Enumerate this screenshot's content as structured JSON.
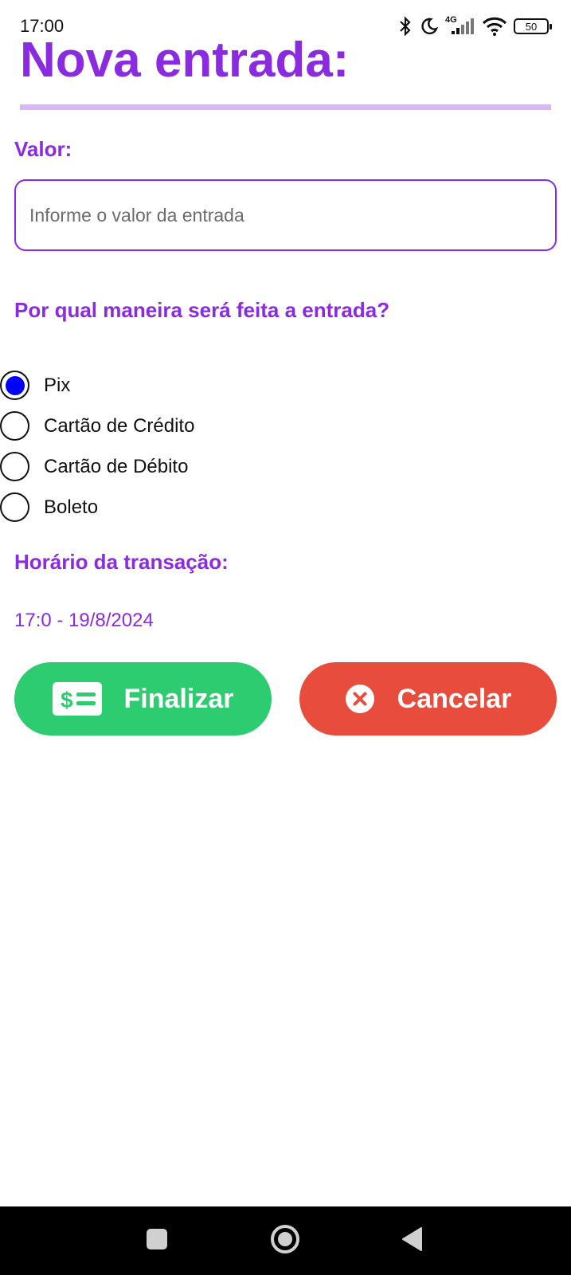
{
  "status_bar": {
    "time": "17:00",
    "network_label": "4G",
    "battery": "50",
    "icons": [
      "bluetooth-icon",
      "moon-icon",
      "signal-icon",
      "wifi-icon",
      "battery-icon"
    ]
  },
  "header": {
    "title": "Nova entrada:"
  },
  "form": {
    "value_label": "Valor:",
    "value_placeholder": "Informe o valor da entrada",
    "value": "",
    "method_label": "Por qual maneira será feita a entrada?",
    "methods": [
      {
        "label": "Pix",
        "selected": true
      },
      {
        "label": "Cartão de Crédito",
        "selected": false
      },
      {
        "label": "Cartão de Débito",
        "selected": false
      },
      {
        "label": "Boleto",
        "selected": false
      }
    ],
    "time_label": "Horário da transação:",
    "timestamp": "17:0 - 19/8/2024"
  },
  "actions": {
    "finalize_label": "Finalizar",
    "finalize_icon": "money-bill-icon",
    "cancel_label": "Cancelar",
    "cancel_icon": "close-circle-icon"
  },
  "colors": {
    "accent": "#8a2be2",
    "divider": "#d9b8f8",
    "radio_selected": "#0000ff",
    "finalize": "#2ecc71",
    "cancel": "#e74c3c"
  },
  "nav_bar": {
    "icons": [
      "recents-icon",
      "home-icon",
      "back-icon"
    ]
  }
}
